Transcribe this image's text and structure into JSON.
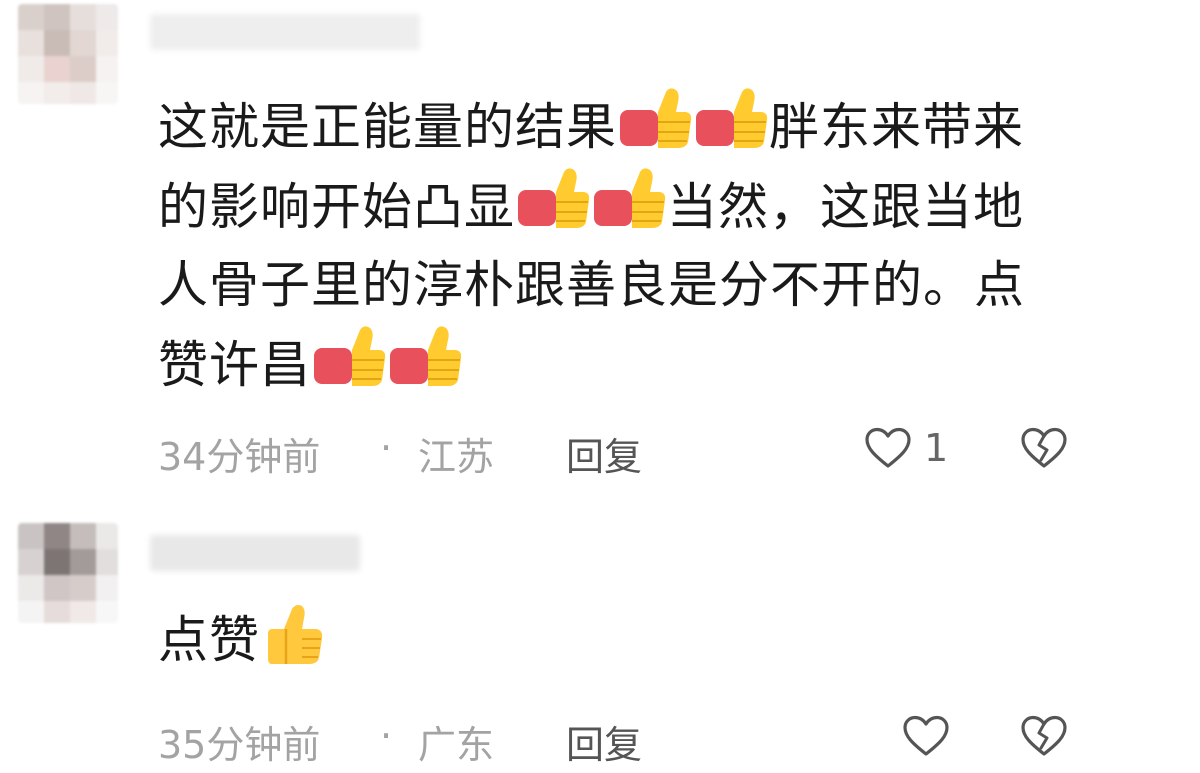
{
  "comments": [
    {
      "segments": [
        {
          "type": "text",
          "value": "这就是正能量的结果"
        },
        {
          "type": "emoji",
          "icon": "thumbs-up-icon"
        },
        {
          "type": "emoji",
          "icon": "thumbs-up-icon"
        },
        {
          "type": "text",
          "value": "胖东来带来的影响开始凸显"
        },
        {
          "type": "emoji",
          "icon": "thumbs-up-icon"
        },
        {
          "type": "emoji",
          "icon": "thumbs-up-icon"
        },
        {
          "type": "text",
          "value": "当然，这跟当地人骨子里的淳朴跟善良是分不开的。点赞许昌"
        },
        {
          "type": "emoji",
          "icon": "thumbs-up-icon"
        },
        {
          "type": "emoji",
          "icon": "thumbs-up-icon"
        }
      ],
      "time": "34分钟前",
      "separator": "·",
      "location": "江苏",
      "reply_label": "回复",
      "like_count": "1",
      "like_icon": "heart-outline-icon",
      "dislike_icon": "broken-heart-icon"
    },
    {
      "segments": [
        {
          "type": "text",
          "value": "点赞"
        },
        {
          "type": "emoji",
          "icon": "thumbs-up-icon"
        }
      ],
      "time": "35分钟前",
      "separator": "·",
      "location": "广东",
      "reply_label": "回复",
      "like_count": "",
      "like_icon": "heart-outline-icon",
      "dislike_icon": "broken-heart-icon"
    }
  ],
  "colors": {
    "text": "#1a1a1a",
    "meta": "#a3a3a3",
    "reply": "#555555",
    "thumb_yellow": "#ffcb2e",
    "thumb_red": "#e8505b"
  }
}
